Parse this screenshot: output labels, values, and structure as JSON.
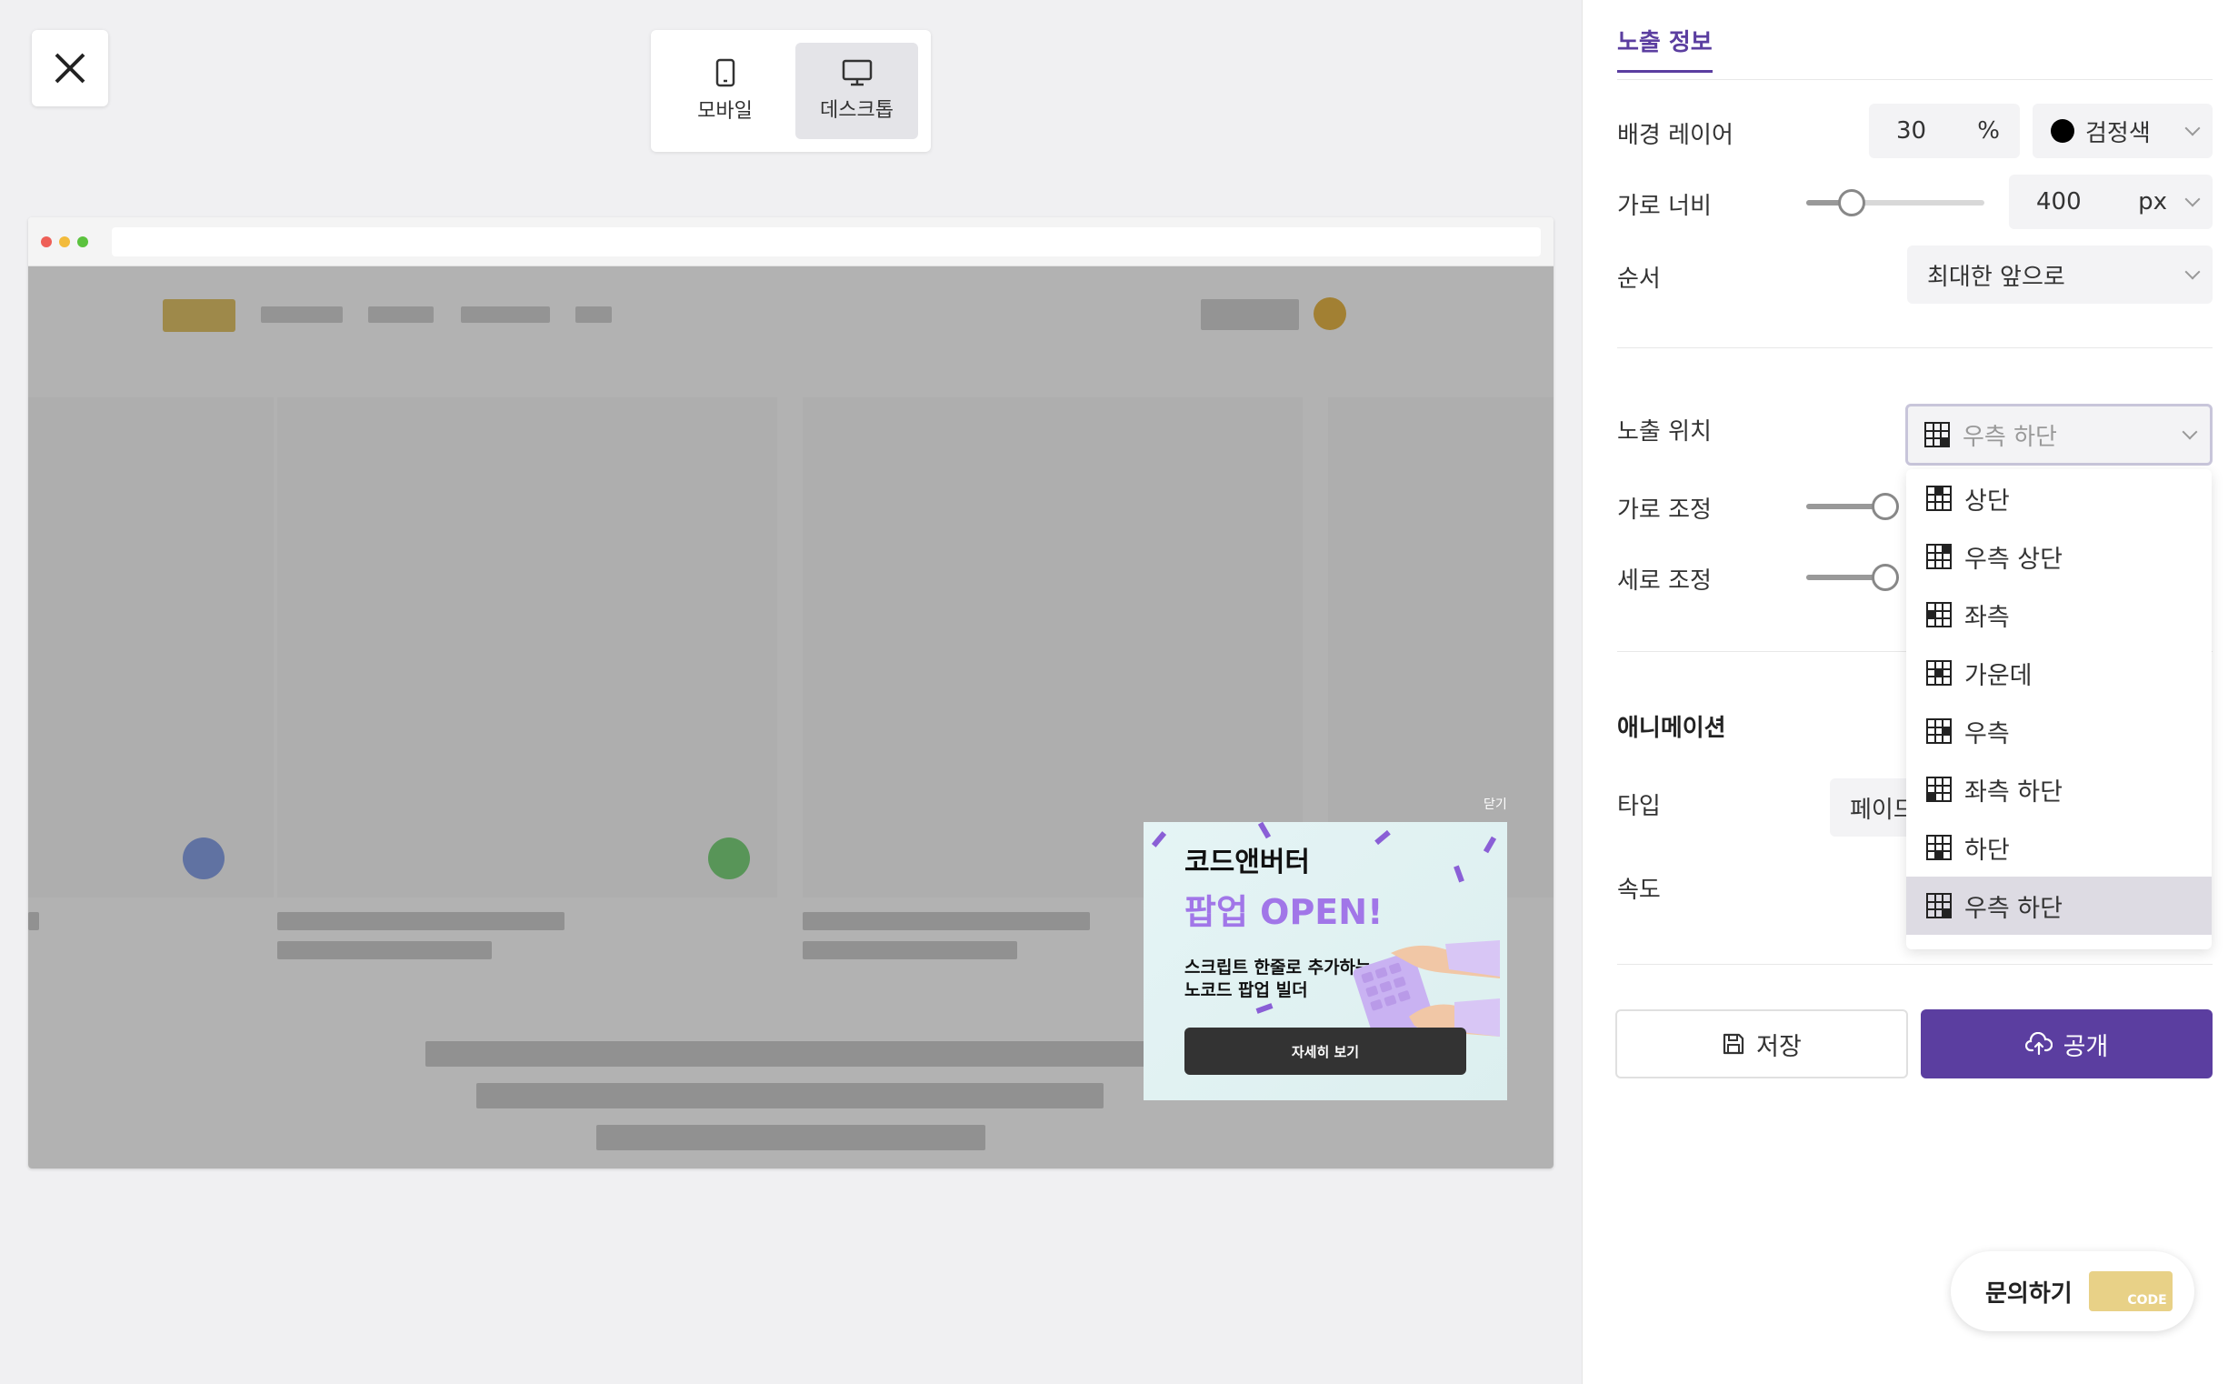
{
  "preview": {
    "device_toggle": {
      "mobile_label": "모바일",
      "desktop_label": "데스크톱",
      "active": "desktop"
    },
    "popup": {
      "close_label": "닫기",
      "title": "코드앤버터",
      "title_highlight": "팝업 OPEN!",
      "subtitle": "스크립트 한줄로 추가하는 노코드 팝업 빌더",
      "button_label": "자세히 보기"
    },
    "colors": {
      "popup_highlight": "#a176e8",
      "accent": "#5b3ea0"
    }
  },
  "panel": {
    "tab_label": "노출 정보",
    "background_layer": {
      "label": "배경 레이어",
      "value": "30",
      "unit": "%",
      "color_label": "검정색"
    },
    "width": {
      "label": "가로 너비",
      "value": "400",
      "unit": "px"
    },
    "order": {
      "label": "순서",
      "value": "최대한 앞으로"
    },
    "position": {
      "label": "노출 위치",
      "value": "우측 하단",
      "options": [
        "상단",
        "우측 상단",
        "좌측",
        "가운데",
        "우측",
        "좌측 하단",
        "하단",
        "우측 하단"
      ],
      "selected_index": 7
    },
    "horizontal_adjust": {
      "label": "가로 조정"
    },
    "vertical_adjust": {
      "label": "세로 조정"
    },
    "animation": {
      "title": "애니메이션",
      "type_label": "타입",
      "type_value": "페이드",
      "speed_label": "속도"
    },
    "save_label": "저장",
    "publish_label": "공개"
  },
  "help": {
    "label": "문의하기",
    "logo_text": "CODE"
  }
}
